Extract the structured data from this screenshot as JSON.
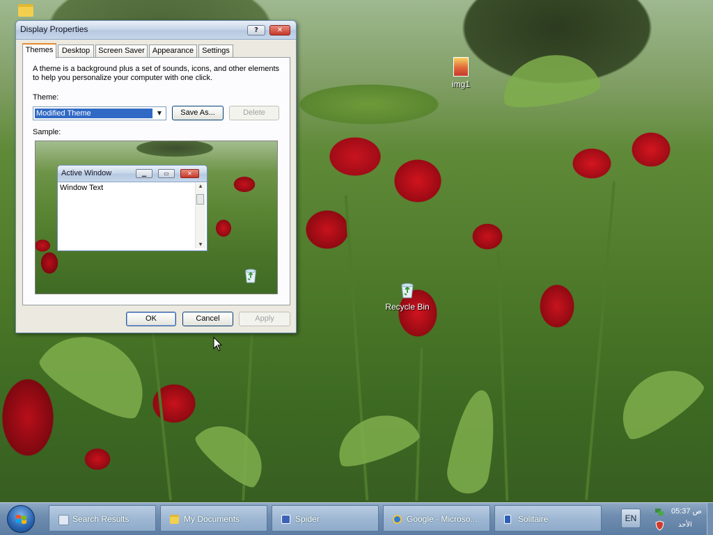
{
  "desktop": {
    "icons": [
      {
        "label": "img1"
      },
      {
        "label": "Recycle Bin"
      }
    ]
  },
  "dialog": {
    "title": "Display Properties",
    "help_label": "?",
    "close_label": "✕",
    "tabs": [
      {
        "label": "Themes",
        "active": true
      },
      {
        "label": "Desktop"
      },
      {
        "label": "Screen Saver"
      },
      {
        "label": "Appearance"
      },
      {
        "label": "Settings"
      }
    ],
    "description": "A theme is a background plus a set of sounds, icons, and other elements to help you personalize your computer with one click.",
    "theme_label": "Theme:",
    "theme_value": "Modified Theme",
    "save_as_label": "Save As...",
    "delete_label": "Delete",
    "sample_label": "Sample:",
    "sample_window": {
      "title": "Active Window",
      "text": "Window Text"
    },
    "ok_label": "OK",
    "cancel_label": "Cancel",
    "apply_label": "Apply"
  },
  "taskbar": {
    "tasks": [
      {
        "label": "Search Results",
        "icon": "search-results-icon",
        "color": "#dfe8f3"
      },
      {
        "label": "My Documents",
        "icon": "folder-icon",
        "color": "#f3cf4e"
      },
      {
        "label": "Spider",
        "icon": "spider-solitaire-icon",
        "color": "#3a62b8"
      },
      {
        "label": "Google - Microso...",
        "icon": "internet-explorer-icon",
        "color": "#2e7bd6"
      },
      {
        "label": "Solitaire",
        "icon": "solitaire-icon",
        "color": "#2e5fb8"
      }
    ],
    "language": "EN",
    "clock": "05:37 ص",
    "day": "الأحد"
  },
  "colors": {
    "selection": "#316ac5",
    "taskbar": "#6f8daf",
    "dialog_bg": "#ece9e0"
  }
}
